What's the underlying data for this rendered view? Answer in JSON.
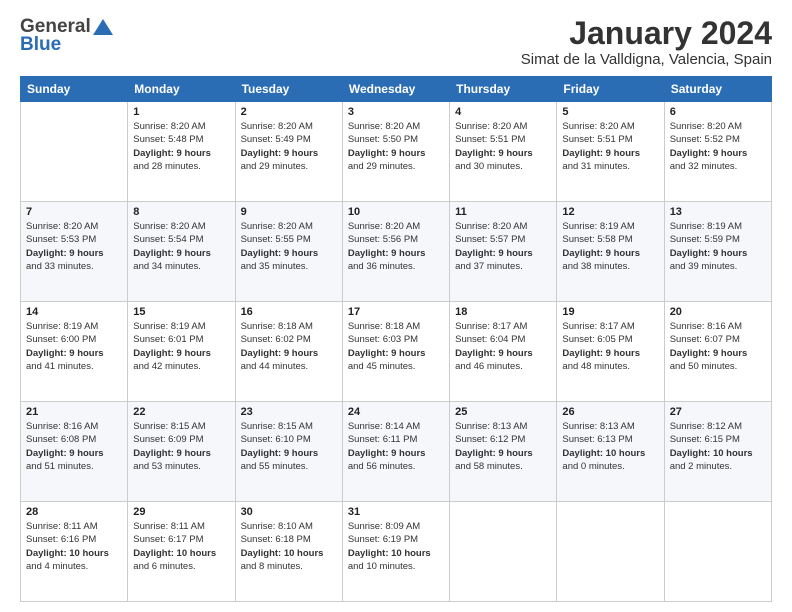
{
  "header": {
    "logo_general": "General",
    "logo_blue": "Blue",
    "month_title": "January 2024",
    "location": "Simat de la Valldigna, Valencia, Spain"
  },
  "days_of_week": [
    "Sunday",
    "Monday",
    "Tuesday",
    "Wednesday",
    "Thursday",
    "Friday",
    "Saturday"
  ],
  "weeks": [
    [
      {
        "day": "",
        "info": ""
      },
      {
        "day": "1",
        "info": "Sunrise: 8:20 AM\nSunset: 5:48 PM\nDaylight: 9 hours\nand 28 minutes."
      },
      {
        "day": "2",
        "info": "Sunrise: 8:20 AM\nSunset: 5:49 PM\nDaylight: 9 hours\nand 29 minutes."
      },
      {
        "day": "3",
        "info": "Sunrise: 8:20 AM\nSunset: 5:50 PM\nDaylight: 9 hours\nand 29 minutes."
      },
      {
        "day": "4",
        "info": "Sunrise: 8:20 AM\nSunset: 5:51 PM\nDaylight: 9 hours\nand 30 minutes."
      },
      {
        "day": "5",
        "info": "Sunrise: 8:20 AM\nSunset: 5:51 PM\nDaylight: 9 hours\nand 31 minutes."
      },
      {
        "day": "6",
        "info": "Sunrise: 8:20 AM\nSunset: 5:52 PM\nDaylight: 9 hours\nand 32 minutes."
      }
    ],
    [
      {
        "day": "7",
        "info": "Sunrise: 8:20 AM\nSunset: 5:53 PM\nDaylight: 9 hours\nand 33 minutes."
      },
      {
        "day": "8",
        "info": "Sunrise: 8:20 AM\nSunset: 5:54 PM\nDaylight: 9 hours\nand 34 minutes."
      },
      {
        "day": "9",
        "info": "Sunrise: 8:20 AM\nSunset: 5:55 PM\nDaylight: 9 hours\nand 35 minutes."
      },
      {
        "day": "10",
        "info": "Sunrise: 8:20 AM\nSunset: 5:56 PM\nDaylight: 9 hours\nand 36 minutes."
      },
      {
        "day": "11",
        "info": "Sunrise: 8:20 AM\nSunset: 5:57 PM\nDaylight: 9 hours\nand 37 minutes."
      },
      {
        "day": "12",
        "info": "Sunrise: 8:19 AM\nSunset: 5:58 PM\nDaylight: 9 hours\nand 38 minutes."
      },
      {
        "day": "13",
        "info": "Sunrise: 8:19 AM\nSunset: 5:59 PM\nDaylight: 9 hours\nand 39 minutes."
      }
    ],
    [
      {
        "day": "14",
        "info": "Sunrise: 8:19 AM\nSunset: 6:00 PM\nDaylight: 9 hours\nand 41 minutes."
      },
      {
        "day": "15",
        "info": "Sunrise: 8:19 AM\nSunset: 6:01 PM\nDaylight: 9 hours\nand 42 minutes."
      },
      {
        "day": "16",
        "info": "Sunrise: 8:18 AM\nSunset: 6:02 PM\nDaylight: 9 hours\nand 44 minutes."
      },
      {
        "day": "17",
        "info": "Sunrise: 8:18 AM\nSunset: 6:03 PM\nDaylight: 9 hours\nand 45 minutes."
      },
      {
        "day": "18",
        "info": "Sunrise: 8:17 AM\nSunset: 6:04 PM\nDaylight: 9 hours\nand 46 minutes."
      },
      {
        "day": "19",
        "info": "Sunrise: 8:17 AM\nSunset: 6:05 PM\nDaylight: 9 hours\nand 48 minutes."
      },
      {
        "day": "20",
        "info": "Sunrise: 8:16 AM\nSunset: 6:07 PM\nDaylight: 9 hours\nand 50 minutes."
      }
    ],
    [
      {
        "day": "21",
        "info": "Sunrise: 8:16 AM\nSunset: 6:08 PM\nDaylight: 9 hours\nand 51 minutes."
      },
      {
        "day": "22",
        "info": "Sunrise: 8:15 AM\nSunset: 6:09 PM\nDaylight: 9 hours\nand 53 minutes."
      },
      {
        "day": "23",
        "info": "Sunrise: 8:15 AM\nSunset: 6:10 PM\nDaylight: 9 hours\nand 55 minutes."
      },
      {
        "day": "24",
        "info": "Sunrise: 8:14 AM\nSunset: 6:11 PM\nDaylight: 9 hours\nand 56 minutes."
      },
      {
        "day": "25",
        "info": "Sunrise: 8:13 AM\nSunset: 6:12 PM\nDaylight: 9 hours\nand 58 minutes."
      },
      {
        "day": "26",
        "info": "Sunrise: 8:13 AM\nSunset: 6:13 PM\nDaylight: 10 hours\nand 0 minutes."
      },
      {
        "day": "27",
        "info": "Sunrise: 8:12 AM\nSunset: 6:15 PM\nDaylight: 10 hours\nand 2 minutes."
      }
    ],
    [
      {
        "day": "28",
        "info": "Sunrise: 8:11 AM\nSunset: 6:16 PM\nDaylight: 10 hours\nand 4 minutes."
      },
      {
        "day": "29",
        "info": "Sunrise: 8:11 AM\nSunset: 6:17 PM\nDaylight: 10 hours\nand 6 minutes."
      },
      {
        "day": "30",
        "info": "Sunrise: 8:10 AM\nSunset: 6:18 PM\nDaylight: 10 hours\nand 8 minutes."
      },
      {
        "day": "31",
        "info": "Sunrise: 8:09 AM\nSunset: 6:19 PM\nDaylight: 10 hours\nand 10 minutes."
      },
      {
        "day": "",
        "info": ""
      },
      {
        "day": "",
        "info": ""
      },
      {
        "day": "",
        "info": ""
      }
    ]
  ]
}
